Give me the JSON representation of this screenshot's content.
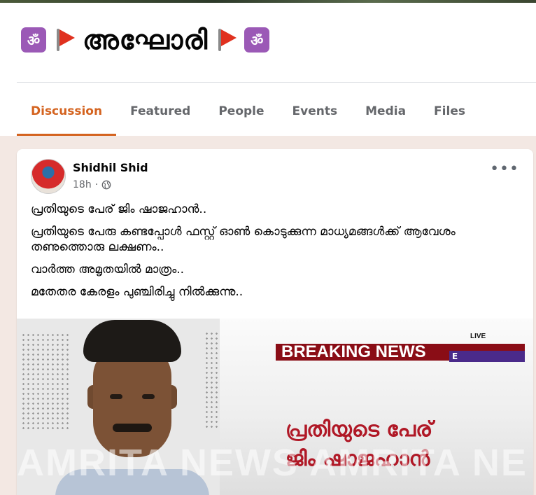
{
  "group": {
    "title": "അഘോരി",
    "title_prefix_icons": [
      "om-icon",
      "red-flag-icon"
    ],
    "title_suffix_icons": [
      "red-flag-icon",
      "om-icon"
    ],
    "om_glyph": "ॐ",
    "tabs": [
      {
        "label": "Discussion",
        "active": true
      },
      {
        "label": "Featured",
        "active": false
      },
      {
        "label": "People",
        "active": false
      },
      {
        "label": "Events",
        "active": false
      },
      {
        "label": "Media",
        "active": false
      },
      {
        "label": "Files",
        "active": false
      }
    ],
    "accent_color": "#d4631f"
  },
  "post": {
    "author": "Shidhil Shid",
    "time": "18h",
    "separator": "·",
    "privacy_icon": "globe-icon",
    "more_label": "•••",
    "paragraphs": [
      "പ്രതിയുടെ പേര് ജിം ഷാജഹാൻ..",
      "പ്രതിയുടെ പേരു കണ്ടപ്പോൾ ഫസ്റ്റ് ഓൺ കൊടുക്കുന്ന മാധ്യമങ്ങൾക്ക് ആവേശം തണുത്തൊരു ലക്ഷണം..",
      "വാർത്ത അമൃതയിൽ മാത്രം..",
      "മതേതര കേരളം പുഞ്ചിരിച്ചു നിൽക്കുന്നു.."
    ],
    "image": {
      "breaking_label": "BREAKING NEWS",
      "breaking_tail": "E",
      "live_label": "LIVE",
      "headline_line1": "പ്രതിയുടെ പേര്",
      "headline_line2": "ജിം ഷാജഹാൻ",
      "watermark": "AMRITA NEWS     AMRITA NE"
    }
  }
}
